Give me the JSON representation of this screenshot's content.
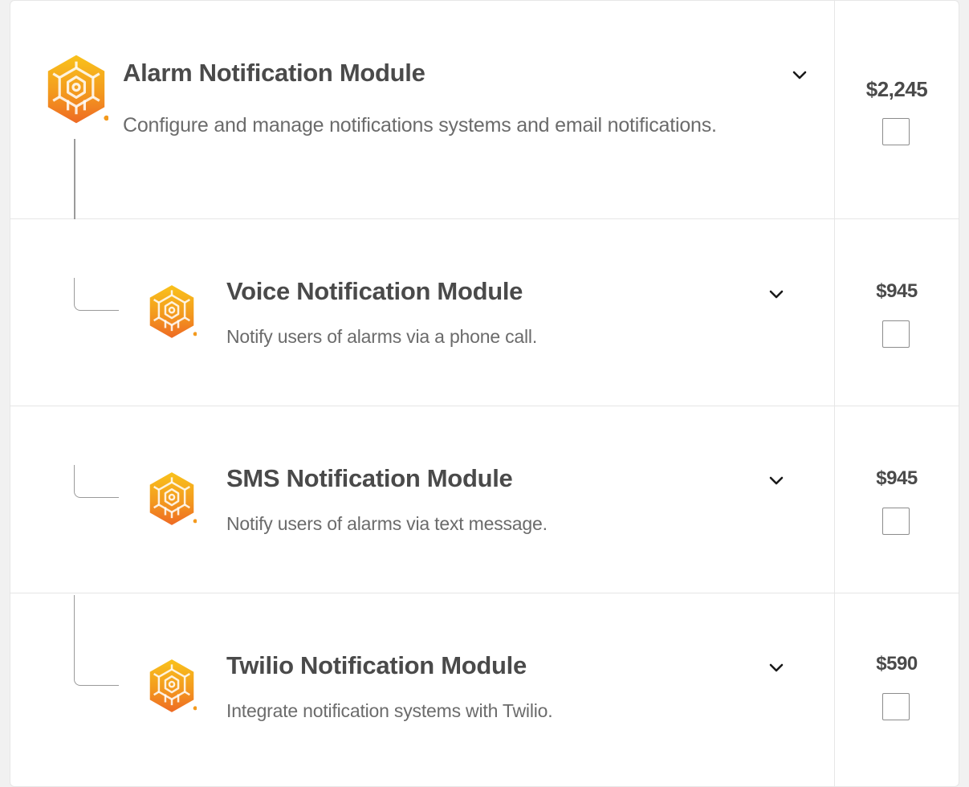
{
  "modules": [
    {
      "title": "Alarm Notification Module",
      "description": "Configure and manage notifications systems and email notifications.",
      "price": "$2,245",
      "checked": false
    },
    {
      "title": "Voice Notification Module",
      "description": "Notify users of alarms via a phone call.",
      "price": "$945",
      "checked": false
    },
    {
      "title": "SMS Notification Module",
      "description": "Notify users of alarms via text message.",
      "price": "$945",
      "checked": false
    },
    {
      "title": "Twilio Notification Module",
      "description": "Integrate notification systems with Twilio.",
      "price": "$590",
      "checked": false
    }
  ],
  "icons": {
    "module": "module-hexagon-icon",
    "expand": "chevron-down-icon"
  },
  "colors": {
    "brand_orange": "#f07a1a",
    "brand_yellow": "#f7b318",
    "text_dark": "#4a4a4a",
    "text_muted": "#6b6b6b"
  }
}
